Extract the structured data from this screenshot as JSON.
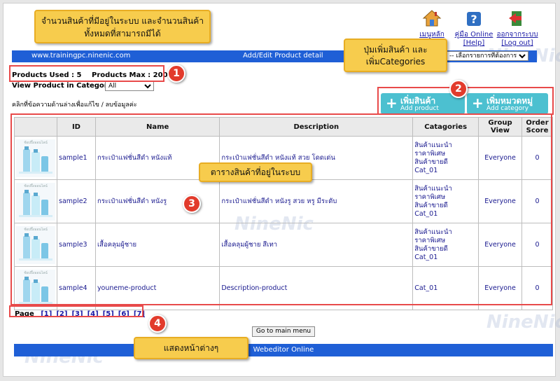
{
  "toolbar": {
    "home_label": "เมนูหลัก",
    "help_label": "คู่มือ Online [Help]",
    "logout_label": "ออกจากระบบ [Log out]"
  },
  "header": {
    "site_url": "www.trainingpc.ninenic.com",
    "title": "Add/Edit Product detail",
    "menu_select": "-- เลือกรายการที่ต้องการ --"
  },
  "summary": {
    "used_label": "Products Used : 5",
    "max_label": "Products Max : 200"
  },
  "filter": {
    "label": "View Product in Category :",
    "value": "All"
  },
  "hint": "คลิกที่ข้อความด้านล่างเพื่อแก้ไข / ลบข้อมูลค่ะ",
  "buttons": {
    "add_product_main": "เพิ่มสินค้า",
    "add_product_sub": "Add product",
    "add_category_main": "เพิ่มหมวดหมู่",
    "add_category_sub": "Add category",
    "main_menu": "Go to main menu"
  },
  "table": {
    "headers": [
      "",
      "ID",
      "Name",
      "Description",
      "Catagories",
      "Group View",
      "Order Score"
    ],
    "thumb_text": "ช้อปปิ้งออนไลน์",
    "rows": [
      {
        "id": "sample1",
        "name": "กระเป๋าแฟชั่นสีดำ หนังแท้",
        "description": "กระเป๋าแฟชั่นสีดำ หนังแท้ สวย โดดเด่น",
        "cats": [
          "สินค้าแนะนำ",
          "ราคาพิเศษ",
          "สินค้าขายดี",
          "Cat_01"
        ],
        "group": "Everyone",
        "score": "0"
      },
      {
        "id": "sample2",
        "name": "กระเป๋าแฟชั่นสีดำ หนังรู",
        "description": "กระเป๋าแฟชั่นสีดำ หนังรู สวย หรู มีระดับ",
        "cats": [
          "สินค้าแนะนำ",
          "ราคาพิเศษ",
          "สินค้าขายดี",
          "Cat_01"
        ],
        "group": "Everyone",
        "score": "0"
      },
      {
        "id": "sample3",
        "name": "เสื้อคลุมผู้ชาย",
        "description": "เสื้อคลุมผู้ชาย สีเทา",
        "cats": [
          "สินค้าแนะนำ",
          "ราคาพิเศษ",
          "สินค้าขายดี",
          "Cat_01"
        ],
        "group": "Everyone",
        "score": "0"
      },
      {
        "id": "sample4",
        "name": "youneme-product",
        "description": "Description-product",
        "cats": [
          "Cat_01"
        ],
        "group": "Everyone",
        "score": "0"
      }
    ]
  },
  "pager": {
    "label": "Page",
    "pages": [
      "[1]",
      "[2]",
      "[3]",
      "[4]",
      "[5]",
      "[6]",
      "[7]"
    ]
  },
  "footer": "Webeditor Online",
  "callouts": {
    "c1": "จำนวนสินค้าที่มีอยู่ในระบบ และจำนวนสินค้าทั้งหมดที่สามารถมีได้",
    "c2": "ปุ่มเพิ่มสินค้า และเพิ่มCategories",
    "c3": "ตารางสินค้าที่อยู่ในระบบ",
    "c4": "แสดงหน้าต่างๆ"
  },
  "badges": [
    "1",
    "2",
    "3",
    "4"
  ],
  "watermark": "NineNic",
  "colors": {
    "accent_blue": "#1f5fd6",
    "button_teal": "#4cc0d0",
    "callout_yellow": "#f7cc4d",
    "badge_red": "#e23b2c"
  }
}
